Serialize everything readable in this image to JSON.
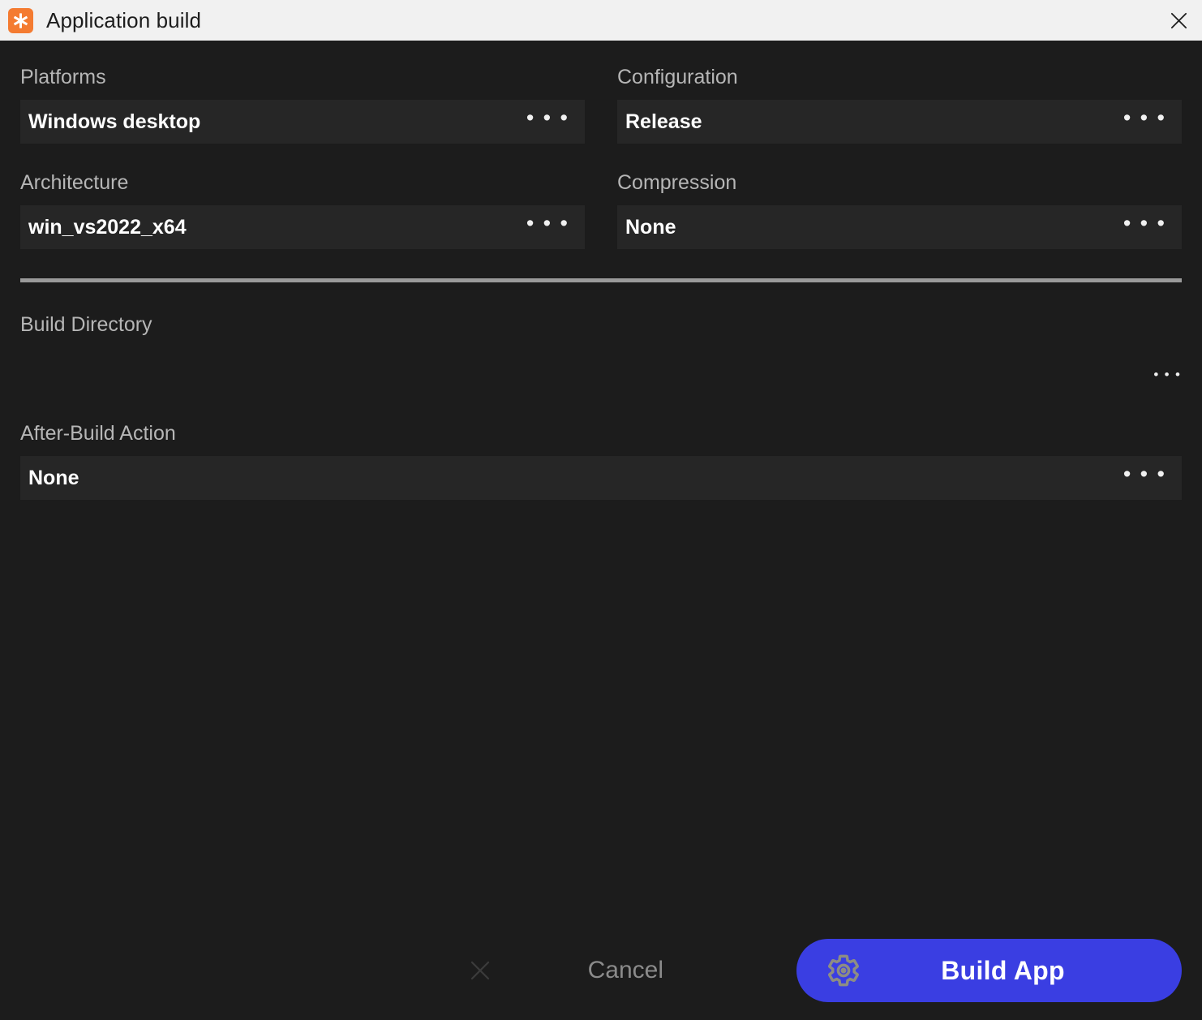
{
  "window": {
    "title": "Application build",
    "app_icon": "asterisk-icon",
    "close_icon": "close-icon",
    "bg_color": "#1c1c1c",
    "titlebar_color": "#f1f1f1",
    "icon_color": "#f47b31"
  },
  "fields": {
    "platforms": {
      "label": "Platforms",
      "value": "Windows desktop",
      "more": "• • •"
    },
    "configuration": {
      "label": "Configuration",
      "value": "Release",
      "more": "• • •"
    },
    "architecture": {
      "label": "Architecture",
      "value": "win_vs2022_x64",
      "more": "• • •"
    },
    "compression": {
      "label": "Compression",
      "value": "None",
      "more": "• • •"
    },
    "build_directory": {
      "label": "Build Directory",
      "value": "",
      "placeholder": "",
      "more": "• • •"
    },
    "after_build_action": {
      "label": "After-Build Action",
      "value": "None",
      "more": "• • •"
    }
  },
  "footer": {
    "dismiss_icon": "close-icon",
    "cancel_label": "Cancel",
    "build_label": "Build App",
    "build_icon": "gear-icon",
    "build_color": "#3a3ee2"
  }
}
